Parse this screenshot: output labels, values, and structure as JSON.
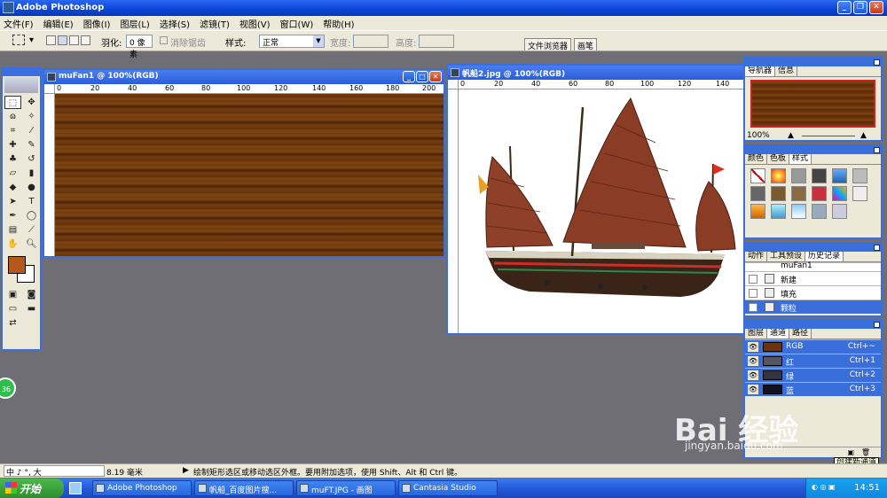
{
  "app": {
    "title": "Adobe Photoshop"
  },
  "menu": [
    "文件(F)",
    "编辑(E)",
    "图像(I)",
    "图层(L)",
    "选择(S)",
    "滤镜(T)",
    "视图(V)",
    "窗口(W)",
    "帮助(H)"
  ],
  "options": {
    "feather_label": "羽化:",
    "feather_value": "0 像素",
    "antialias_label": "消除锯齿",
    "style_label": "样式:",
    "style_value": "正常",
    "width_label": "宽度:",
    "height_label": "高度:",
    "file_browser_tab": "文件浏览器",
    "brushes_tab": "画笔"
  },
  "doc1": {
    "title": "muFan1 @ 100%(RGB)",
    "ruler_ticks": [
      "0",
      "20",
      "40",
      "60",
      "80",
      "100",
      "120",
      "140",
      "160",
      "180",
      "200"
    ]
  },
  "doc2": {
    "title": "帆船2.jpg @ 100%(RGB)",
    "ruler_ticks": [
      "0",
      "20",
      "40",
      "60",
      "80",
      "100",
      "120",
      "140"
    ]
  },
  "navigator": {
    "tabs": [
      "导航器",
      "信息"
    ],
    "zoom": "100%"
  },
  "styles_palette": {
    "tabs": [
      "颜色",
      "色板",
      "样式"
    ]
  },
  "history": {
    "tabs": [
      "动作",
      "工具预设",
      "历史记录"
    ],
    "snapshot": "muFan1",
    "items": [
      {
        "label": "新建",
        "active": false
      },
      {
        "label": "填充",
        "active": false
      },
      {
        "label": "颗粒",
        "active": true
      }
    ]
  },
  "channels": {
    "tabs": [
      "图层",
      "通道",
      "路径"
    ],
    "rows": [
      {
        "name": "RGB",
        "shortcut": "Ctrl+~",
        "thumb": "#6b3309"
      },
      {
        "name": "红",
        "shortcut": "Ctrl+1",
        "thumb": "#555566"
      },
      {
        "name": "绿",
        "shortcut": "Ctrl+2",
        "thumb": "#333344"
      },
      {
        "name": "蓝",
        "shortcut": "Ctrl+3",
        "thumb": "#111122"
      }
    ],
    "tooltip": "创建新通道"
  },
  "status": {
    "ime": "中 ♪ °, 大",
    "zoom": "8.19 毫米",
    "message": "绘制矩形选区或移动选区外框。要用附加选项，使用 Shift、Alt 和 Ctrl 键。"
  },
  "taskbar": {
    "start": "开始",
    "buttons": [
      "Adobe Photoshop",
      "帆船_百度图片搜...",
      "muFT.JPG - 画图",
      "Cantasia Studio"
    ],
    "clock": "14:51"
  },
  "badge": "36",
  "watermark": {
    "main": "Bai 经验",
    "sub": "jingyan.baidu.com"
  },
  "colors": {
    "foreground": "#b5581b",
    "background": "#ffffff",
    "accent": "#3a6edb"
  }
}
